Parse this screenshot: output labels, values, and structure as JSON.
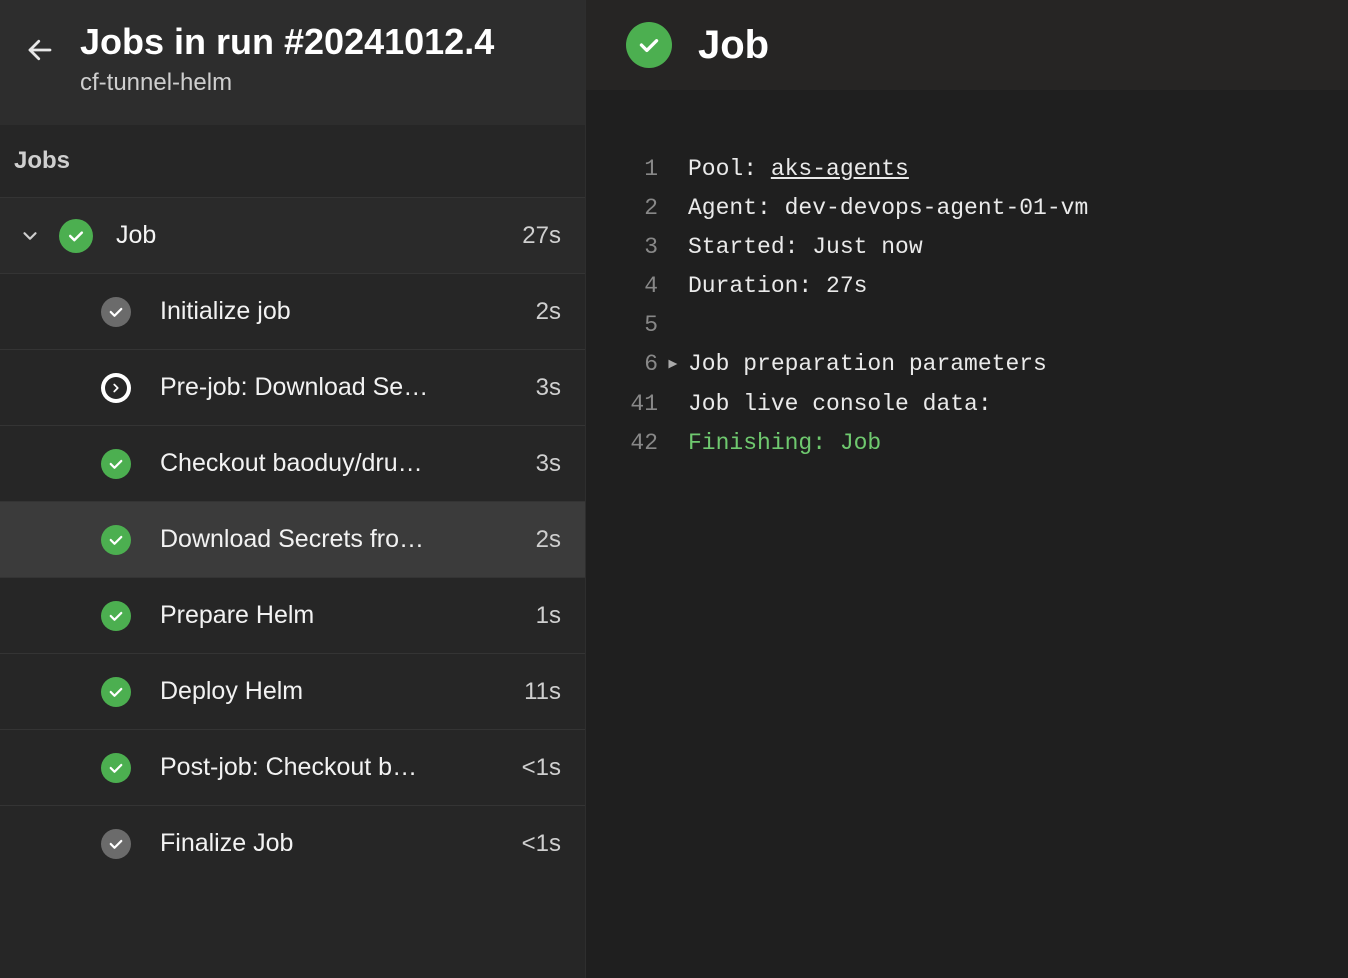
{
  "sidebar": {
    "title": "Jobs in run #20241012.4",
    "subtitle": "cf-tunnel-helm",
    "section_label": "Jobs",
    "job": {
      "label": "Job",
      "duration": "27s",
      "status": "success"
    },
    "steps": [
      {
        "status": "gray",
        "label": "Initialize job",
        "duration": "2s",
        "selected": false
      },
      {
        "status": "running",
        "label": "Pre-job: Download Se…",
        "duration": "3s",
        "selected": false
      },
      {
        "status": "success",
        "label": "Checkout baoduy/dru…",
        "duration": "3s",
        "selected": false
      },
      {
        "status": "success",
        "label": "Download Secrets fro…",
        "duration": "2s",
        "selected": true
      },
      {
        "status": "success",
        "label": "Prepare Helm",
        "duration": "1s",
        "selected": false
      },
      {
        "status": "success",
        "label": "Deploy Helm",
        "duration": "11s",
        "selected": false
      },
      {
        "status": "success",
        "label": "Post-job: Checkout b…",
        "duration": "<1s",
        "selected": false
      },
      {
        "status": "gray",
        "label": "Finalize Job",
        "duration": "<1s",
        "selected": false
      }
    ]
  },
  "detail": {
    "title": "Job",
    "log_lines": [
      {
        "n": "1",
        "caret": "",
        "text": "Pool: ",
        "link": "aks-agents",
        "cls": ""
      },
      {
        "n": "2",
        "caret": "",
        "text": "Agent: dev-devops-agent-01-vm",
        "cls": ""
      },
      {
        "n": "3",
        "caret": "",
        "text": "Started: Just now",
        "cls": ""
      },
      {
        "n": "4",
        "caret": "",
        "text": "Duration: 27s",
        "cls": ""
      },
      {
        "n": "5",
        "caret": "",
        "text": "",
        "cls": ""
      },
      {
        "n": "6",
        "caret": "▸",
        "text": "Job preparation parameters",
        "cls": ""
      },
      {
        "n": "41",
        "caret": "",
        "text": "Job live console data:",
        "cls": ""
      },
      {
        "n": "42",
        "caret": "",
        "text": "Finishing: Job",
        "cls": "green"
      }
    ]
  }
}
